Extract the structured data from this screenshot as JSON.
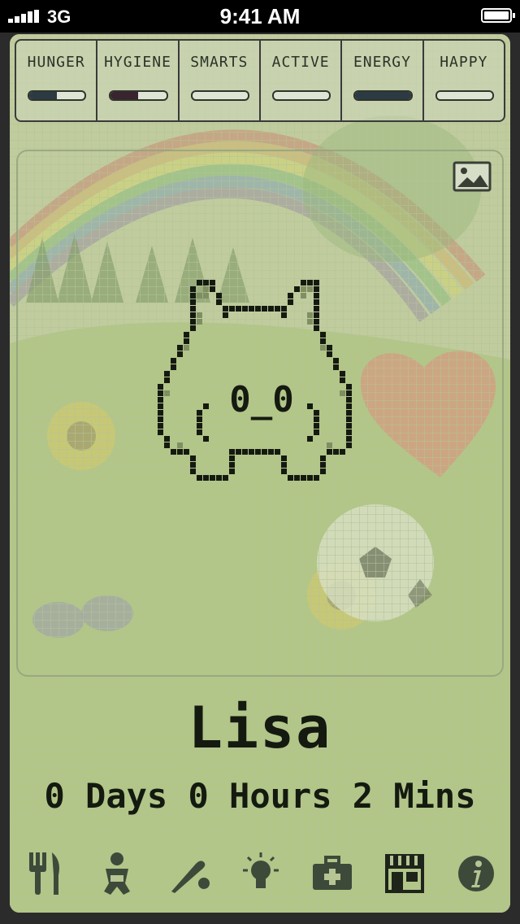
{
  "status_bar": {
    "carrier": "3G",
    "time": "9:41 AM"
  },
  "stats": [
    {
      "label": "HUNGER",
      "level": 0.5
    },
    {
      "label": "HYGIENE",
      "level": 0.5
    },
    {
      "label": "SMARTS",
      "level": 0.0
    },
    {
      "label": "ACTIVE",
      "level": 0.0
    },
    {
      "label": "ENERGY",
      "level": 1.0
    },
    {
      "label": "HAPPY",
      "level": 0.0
    }
  ],
  "pet": {
    "name": "Lisa",
    "age": "0 Days 0 Hours 2 Mins",
    "face": "0_0"
  },
  "toolbar": [
    {
      "icon": "fork-knife-icon"
    },
    {
      "icon": "baby-icon"
    },
    {
      "icon": "baseball-bat-icon"
    },
    {
      "icon": "lightbulb-icon"
    },
    {
      "icon": "first-aid-kit-icon"
    },
    {
      "icon": "shop-icon"
    },
    {
      "icon": "info-icon"
    }
  ],
  "colors": {
    "lcd": "#b7c494",
    "ink": "#141a10",
    "stat_fill": "#2c3a44"
  }
}
